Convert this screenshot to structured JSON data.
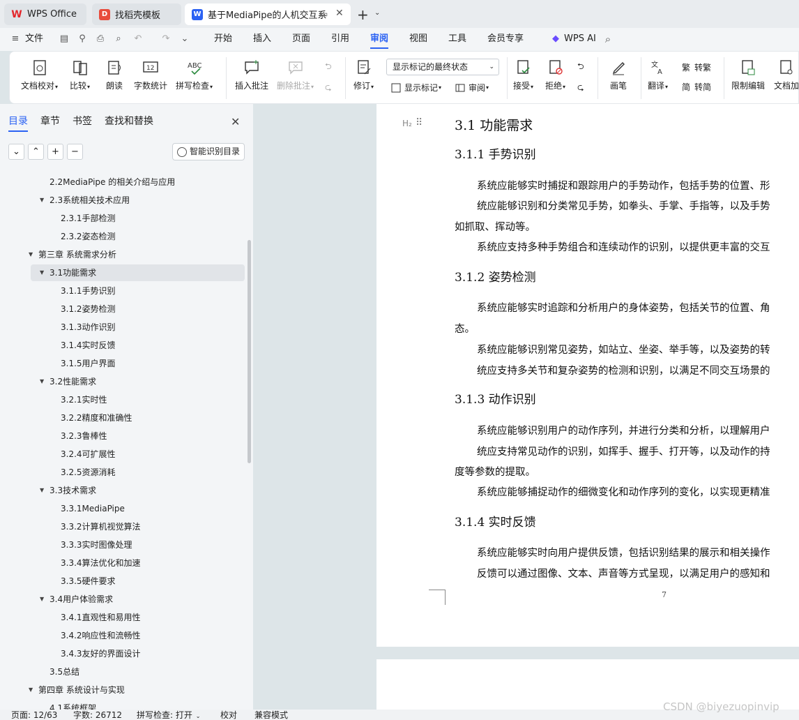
{
  "tabs": [
    {
      "label": "WPS Office",
      "icon": "wps-logo-icon"
    },
    {
      "label": "找稻壳模板",
      "icon": "docer-icon"
    },
    {
      "label": "基于MediaPipe的人机交互系",
      "icon": "word-doc-icon"
    }
  ],
  "menu": {
    "file": "文件",
    "items": [
      "开始",
      "插入",
      "页面",
      "引用",
      "审阅",
      "视图",
      "工具",
      "会员专享"
    ],
    "wps_ai": "WPS AI"
  },
  "ribbon": {
    "proofread": "文档校对",
    "compare": "比较",
    "read_aloud": "朗读",
    "word_count": "字数统计",
    "spell_check": "拼写检查",
    "insert_comment": "插入批注",
    "delete_comment": "删除批注",
    "revise": "修订",
    "markup_state": "显示标记的最终状态",
    "show_markup": "显示标记",
    "review": "审阅",
    "accept": "接受",
    "reject": "拒绝",
    "brush": "画笔",
    "translate": "翻译",
    "to_traditional": "转繁",
    "to_simplified": "转简",
    "restrict_edit": "限制编辑",
    "doc_encrypt": "文档加"
  },
  "nav": {
    "tabs": [
      "目录",
      "章节",
      "书签",
      "查找和替换"
    ],
    "smart_toc": "智能识别目录",
    "toc": [
      "2.2MediaPipe 的相关介绍与应用",
      "2.3系统相关技术应用",
      "2.3.1手部检测",
      "2.3.2姿态检测",
      "第三章 系统需求分析",
      "3.1功能需求",
      "3.1.1手势识别",
      "3.1.2姿势检测",
      "3.1.3动作识别",
      "3.1.4实时反馈",
      "3.1.5用户界面",
      "3.2性能需求",
      "3.2.1实时性",
      "3.2.2精度和准确性",
      "3.2.3鲁棒性",
      "3.2.4可扩展性",
      "3.2.5资源消耗",
      "3.3技术需求",
      "3.3.1MediaPipe",
      "3.3.2计算机视觉算法",
      "3.3.3实时图像处理",
      "3.3.4算法优化和加速",
      "3.3.5硬件要求",
      "3.4用户体验需求",
      "3.4.1直观性和易用性",
      "3.4.2响应性和流畅性",
      "3.4.3友好的界面设计",
      "3.5总结",
      "第四章 系统设计与实现",
      "4.1系统框架"
    ]
  },
  "document": {
    "heading_marker": "H₂",
    "h2": "3.1 功能需求",
    "s311": "3.1.1 手势识别",
    "p1": "系统应能够实时捕捉和跟踪用户的手势动作，包括手势的位置、形",
    "p2": "统应能够识别和分类常见手势，如拳头、手掌、手指等，以及手势",
    "p3": "如抓取、挥动等。",
    "p4": "系统应支持多种手势组合和连续动作的识别，以提供更丰富的交互",
    "s312": "3.1.2 姿势检测",
    "p5": "系统应能够实时追踪和分析用户的身体姿势，包括关节的位置、角",
    "p6": "态。",
    "p7": "系统应能够识别常见姿势，如站立、坐姿、举手等，以及姿势的转",
    "p8": "统应支持多关节和复杂姿势的检测和识别，以满足不同交互场景的",
    "s313": "3.1.3 动作识别",
    "p9": "系统应能够识别用户的动作序列，并进行分类和分析，以理解用户",
    "p10": "统应支持常见动作的识别，如挥手、握手、打开等，以及动作的持",
    "p11": "度等参数的提取。",
    "p12": "系统应能够捕捉动作的细微变化和动作序列的变化，以实现更精准",
    "s314": "3.1.4 实时反馈",
    "p13": "系统应能够实时向用户提供反馈，包括识别结果的展示和相关操作",
    "p14": "反馈可以通过图像、文本、声音等方式呈现，以满足用户的感知和",
    "page_number": "7"
  },
  "status": {
    "page": "页面: 12/63",
    "words": "字数: 26712",
    "spell": "拼写检查: 打开",
    "proof": "校对",
    "compat": "兼容模式"
  },
  "watermark": "CSDN @biyezuopinvip"
}
